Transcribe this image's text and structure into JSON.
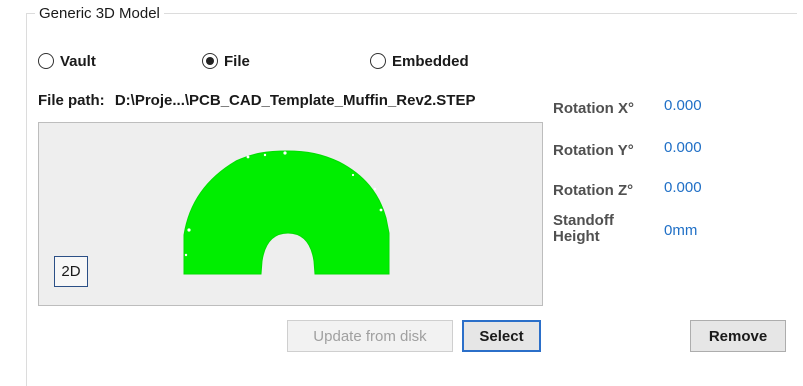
{
  "group": {
    "title": "Generic 3D Model"
  },
  "radios": [
    {
      "label": "Vault",
      "selected": false
    },
    {
      "label": "File",
      "selected": true
    },
    {
      "label": "Embedded",
      "selected": false
    }
  ],
  "file_path": {
    "label": "File path:",
    "value": "D:\\Proje...\\PCB_CAD_Template_Muffin_Rev2.STEP"
  },
  "preview": {
    "view_button": "2D",
    "shape_color": "#00ee00",
    "background_color": "#eeeeee"
  },
  "properties": {
    "rotation_x": {
      "label": "Rotation X°",
      "value": "0.000"
    },
    "rotation_y": {
      "label": "Rotation Y°",
      "value": "0.000"
    },
    "rotation_z": {
      "label": "Rotation Z°",
      "value": "0.000"
    },
    "standoff": {
      "label_line1": "Standoff",
      "label_line2": "Height",
      "value": "0mm"
    }
  },
  "buttons": {
    "update_label": "Update from disk",
    "select_label": "Select",
    "remove_label": "Remove"
  },
  "colors": {
    "value_blue": "#1f6fc6",
    "accent_border": "#2b6fc9"
  }
}
